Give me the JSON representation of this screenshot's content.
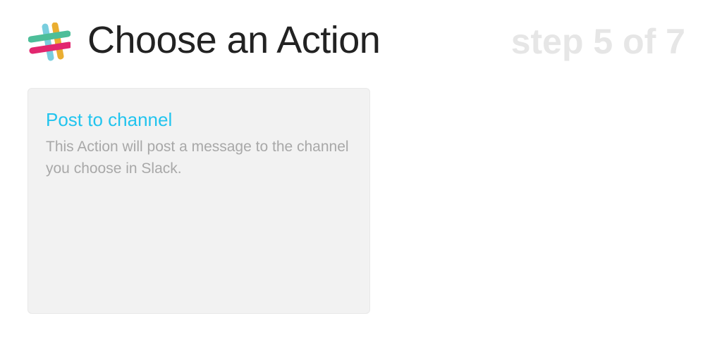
{
  "header": {
    "title": "Choose an Action",
    "step": "step 5 of 7",
    "logo_icon": "slack-logo-icon"
  },
  "actions": [
    {
      "title": "Post to channel",
      "description": "This Action will post a message to the channel you choose in Slack."
    }
  ],
  "colors": {
    "title_text": "#222222",
    "step_text": "#e6e6e6",
    "action_title": "#22c4ee",
    "action_description": "#a8a8a8",
    "card_background": "#f2f2f2",
    "slack_blue": "#6ecadc",
    "slack_green": "#3eb991",
    "slack_yellow": "#e9a820",
    "slack_pink": "#e01563"
  }
}
